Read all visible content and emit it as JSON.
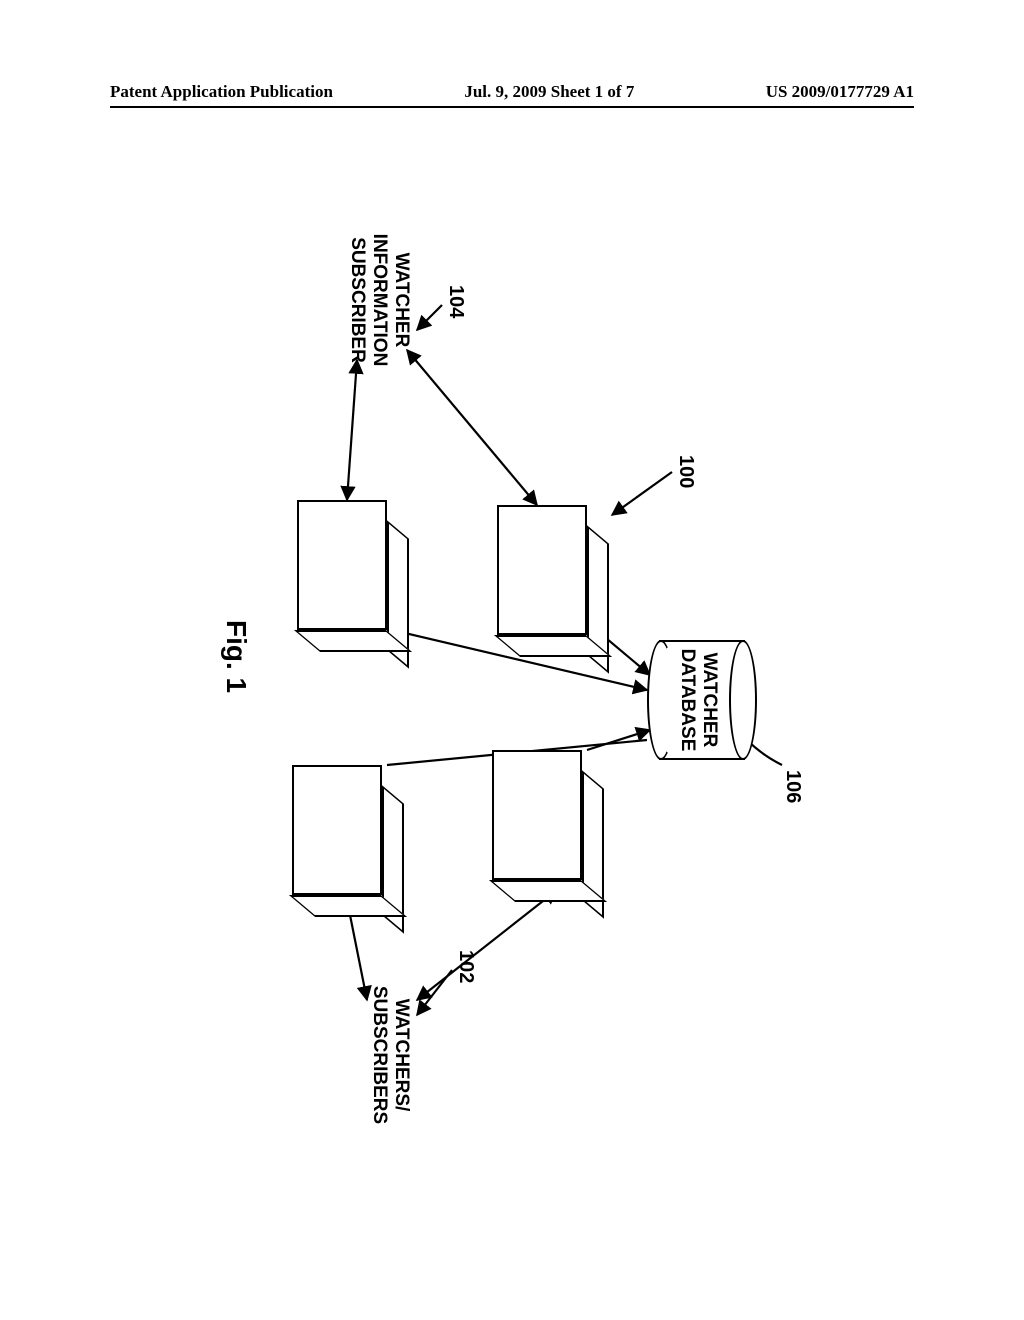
{
  "header": {
    "left": "Patent Application Publication",
    "center": "Jul. 9, 2009  Sheet 1 of 7",
    "right": "US 2009/0177729 A1"
  },
  "figure": {
    "caption": "Fig. 1",
    "refs": {
      "system": "100",
      "watchers": "102",
      "watcher_info_sub": "104",
      "database": "106"
    },
    "labels": {
      "watchers": "WATCHERS/\nSUBSCRIBERS",
      "watcher_info_sub": "WATCHER\nINFORMATION\nSUBSCRIBER",
      "database": "WATCHER\nDATABASE"
    }
  }
}
